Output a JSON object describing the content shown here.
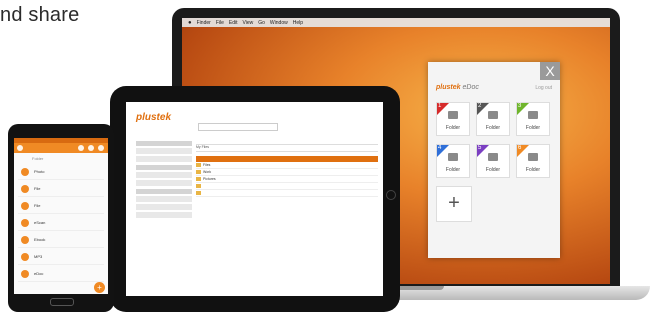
{
  "headline": "nd share",
  "laptop": {
    "menubar": [
      "Finder",
      "File",
      "Edit",
      "View",
      "Go",
      "Window",
      "Help"
    ]
  },
  "edoc": {
    "close_glyph": "X",
    "logo_brand": "plustek",
    "logo_product": "eDoc",
    "logout_label": "Log out",
    "add_glyph": "+",
    "tiles": [
      {
        "num": "1",
        "label": "Folder",
        "color": "#d62b2b"
      },
      {
        "num": "2",
        "label": "Folder",
        "color": "#555555"
      },
      {
        "num": "3",
        "label": "Folder",
        "color": "#6fb52c"
      },
      {
        "num": "4",
        "label": "Folder",
        "color": "#2f6fd8"
      },
      {
        "num": "5",
        "label": "Folder",
        "color": "#7b3fc2"
      },
      {
        "num": "6",
        "label": "Folder",
        "color": "#f08a24"
      }
    ]
  },
  "tablet": {
    "logo": "plustek",
    "section_title": "My Files",
    "rows": [
      "Files",
      "Work",
      "Pictures"
    ]
  },
  "phone": {
    "path": "Folder",
    "items": [
      "Photo",
      "File",
      "File",
      "eScan",
      "Ebook",
      "MP3",
      "eDoc"
    ],
    "fab": "+"
  },
  "colors": {
    "accent": "#f08a24"
  }
}
